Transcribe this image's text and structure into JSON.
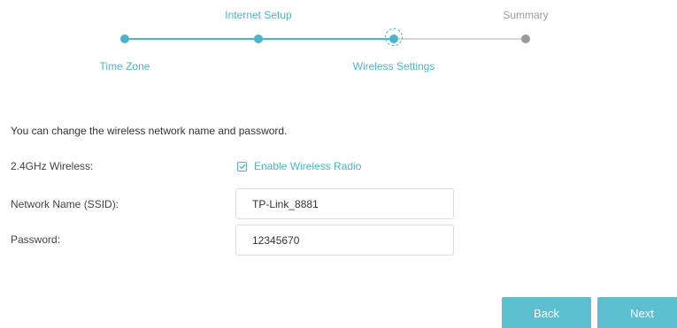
{
  "wizard": {
    "steps": [
      {
        "label": "Time Zone",
        "state": "done"
      },
      {
        "label": "Internet Setup",
        "state": "done"
      },
      {
        "label": "Wireless Settings",
        "state": "current"
      },
      {
        "label": "Summary",
        "state": "pending"
      }
    ],
    "colors": {
      "active": "#4ab5c9",
      "pending": "#9a9a9a",
      "track_pending": "#d6d6d6"
    }
  },
  "form": {
    "intro": "You can change the wireless network name and password.",
    "wireless": {
      "label": "2.4GHz Wireless:",
      "checkbox_label": "Enable Wireless Radio",
      "checked": true
    },
    "ssid": {
      "label": "Network Name (SSID):",
      "value": "TP-Link_8881"
    },
    "password": {
      "label": "Password:",
      "value": "12345670"
    }
  },
  "buttons": {
    "back": "Back",
    "next": "Next",
    "color": "#5bbfcf"
  }
}
